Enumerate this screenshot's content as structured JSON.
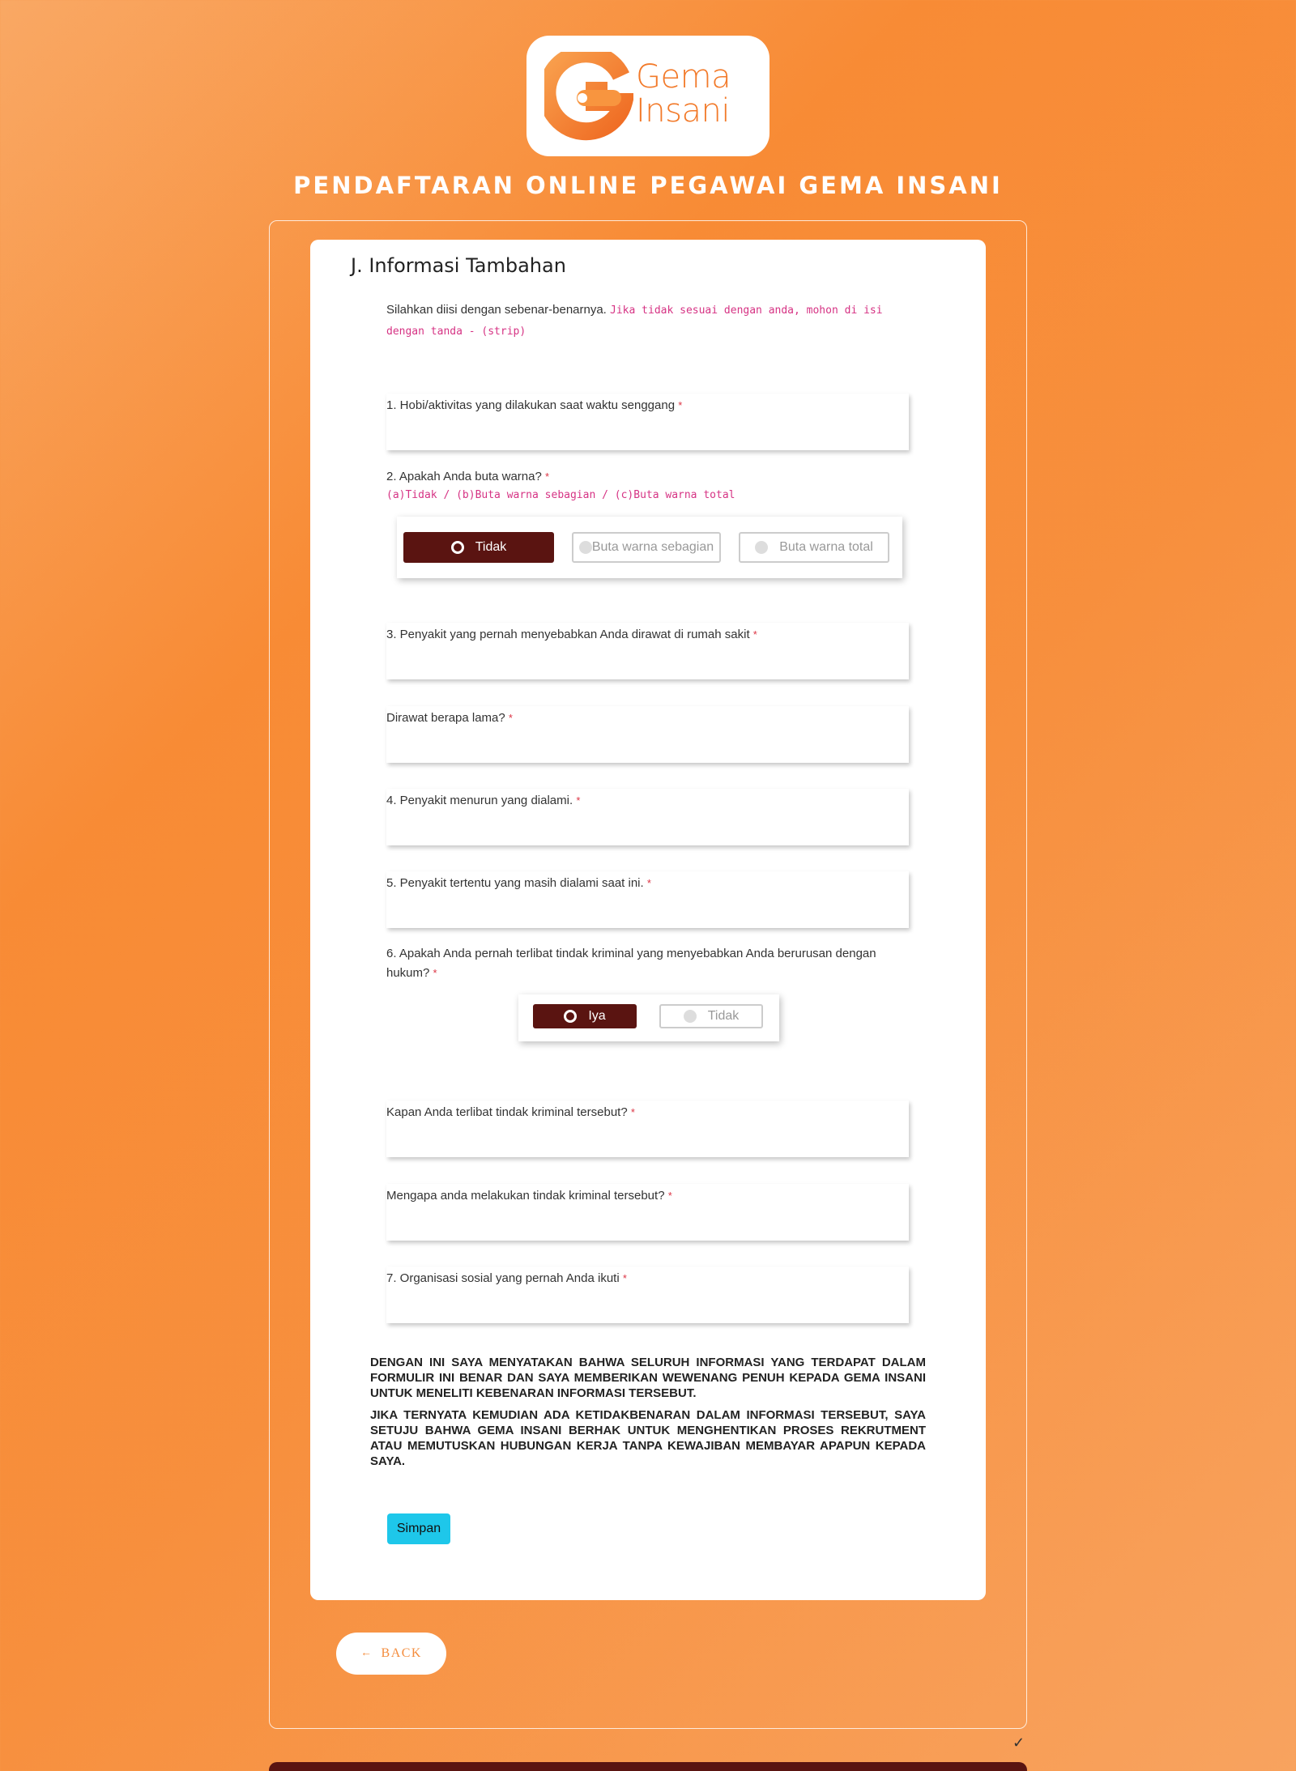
{
  "logo": {
    "line1": "Gema",
    "line2": "Insani",
    "colors": {
      "orange": "#f27a2a",
      "orange_light": "#f9a24f"
    }
  },
  "page_title": "PENDAFTARAN ONLINE PEGAWAI GEMA INSANI",
  "section": {
    "title": "J. Informasi Tambahan",
    "intro_text": "Silahkan diisi dengan sebenar-benarnya.",
    "intro_note": "Jika tidak sesuai dengan anda, mohon di isi dengan tanda - (strip)"
  },
  "required_mark": "*",
  "fields": {
    "hobi": {
      "label": "1. Hobi/aktivitas yang dilakukan saat waktu senggang",
      "value": ""
    },
    "buta_warna": {
      "label": "2. Apakah Anda buta warna?",
      "hint": "(a)Tidak / (b)Buta warna sebagian / (c)Buta warna total",
      "options": [
        "Tidak",
        "Buta warna sebagian",
        "Buta warna total"
      ],
      "selected": "Tidak"
    },
    "penyakit_rawat": {
      "label": "3. Penyakit yang pernah menyebabkan Anda dirawat di rumah sakit",
      "value": ""
    },
    "lama_rawat": {
      "label": "Dirawat berapa lama?",
      "value": ""
    },
    "penyakit_menurun": {
      "label": "4. Penyakit menurun yang dialami.",
      "value": ""
    },
    "penyakit_sekarang": {
      "label": "5. Penyakit tertentu yang masih dialami saat ini.",
      "value": ""
    },
    "kriminal": {
      "label": "6. Apakah Anda pernah terlibat tindak kriminal yang menyebabkan Anda berurusan dengan hukum?",
      "options": [
        "Iya",
        "Tidak"
      ],
      "selected": "Iya"
    },
    "kapan_kriminal": {
      "label": "Kapan Anda terlibat tindak kriminal tersebut?",
      "value": ""
    },
    "mengapa_kriminal": {
      "label": "Mengapa anda melakukan tindak kriminal tersebut?",
      "value": ""
    },
    "organisasi": {
      "label": "7. Organisasi sosial yang pernah Anda ikuti",
      "value": ""
    }
  },
  "declaration": {
    "p1": "DENGAN INI SAYA MENYATAKAN BAHWA SELURUH INFORMASI YANG TERDAPAT DALAM FORMULIR INI BENAR DAN SAYA MEMBERIKAN WEWENANG PENUH KEPADA GEMA INSANI UNTUK MENELITI KEBENARAN INFORMASI TERSEBUT.",
    "p2": "JIKA TERNYATA KEMUDIAN ADA KETIDAKBENARAN DALAM INFORMASI TERSEBUT, SAYA SETUJU BAHWA GEMA INSANI BERHAK UNTUK MENGHENTIKAN PROSES REKRUTMENT ATAU MEMUTUSKAN HUBUNGAN KERJA TANPA KEWAJIBAN MEMBAYAR APAPUN KEPADA SAYA."
  },
  "buttons": {
    "save": "Simpan",
    "back": "BACK",
    "back_icon": "arrow-left-icon"
  },
  "colors": {
    "primary_dark": "#5a1411",
    "save": "#1ec7ea",
    "required": "#dc3545",
    "hint": "#d63384"
  }
}
